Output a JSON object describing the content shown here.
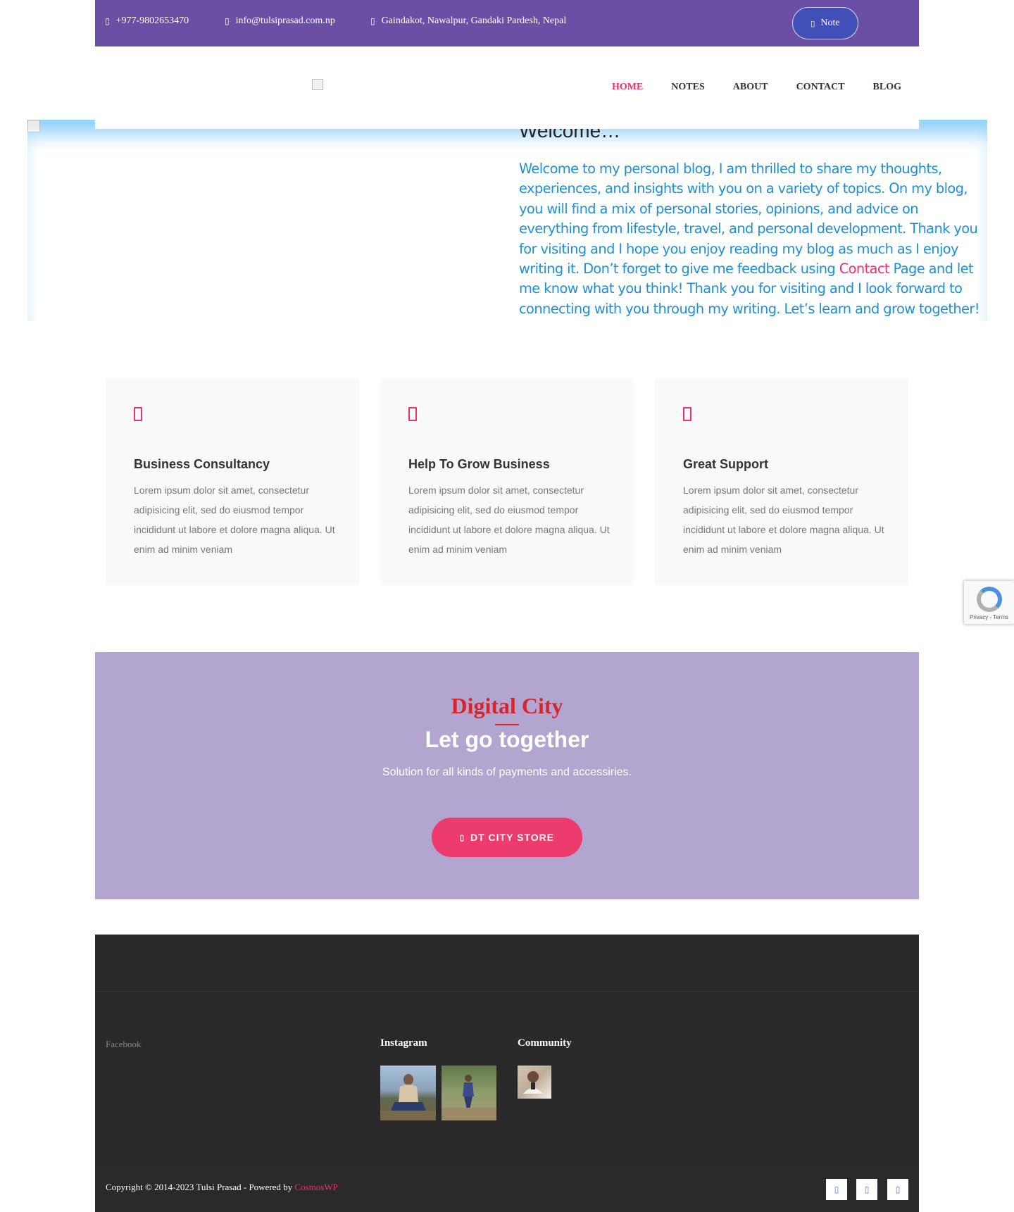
{
  "topbar": {
    "phone": "+977-9802653470",
    "email": "info@tulsiprasad.com.np",
    "address": "Gaindakot, Nawalpur, Gandaki Pardesh, Nepal",
    "note_label": "Note",
    "colors": {
      "bar": "#6a4fa4",
      "note_button": "#4150b8"
    }
  },
  "nav": {
    "items": [
      "HOME",
      "NOTES",
      "ABOUT",
      "CONTACT",
      "BLOG"
    ],
    "active": "HOME",
    "active_color": "#e8336d"
  },
  "hero": {
    "title": "Welcome…",
    "text_before": "Welcome to my personal blog, I am thrilled to share my thoughts, experiences, and insights with you on a variety of topics. On my blog, you will find a mix of personal stories, opinions, and advice on everything from lifestyle, travel, and personal development. Thank you for visiting and I hope you enjoy reading my blog as much as I enjoy writing it. Don’t forget to give me feedback using ",
    "link_text": "Contact",
    "text_after": " Page and let me know what you think! Thank you for visiting and I look forward to connecting with you through my writing. Let’s learn and grow together!"
  },
  "features": [
    {
      "title": "Business Consultancy",
      "text": "Lorem ipsum dolor sit amet, consectetur adipisicing elit, sed do eiusmod tempor incididunt ut labore et dolore magna aliqua. Ut enim ad minim veniam"
    },
    {
      "title": "Help To Grow Business",
      "text": "Lorem ipsum dolor sit amet, consectetur adipisicing elit, sed do eiusmod tempor incididunt ut labore et dolore magna aliqua. Ut enim ad minim veniam"
    },
    {
      "title": "Great Support",
      "text": "Lorem ipsum dolor sit amet, consectetur adipisicing elit, sed do eiusmod tempor incididunt ut labore et dolore magna aliqua. Ut enim ad minim veniam"
    }
  ],
  "recaptcha": {
    "text": "Privacy - Terms"
  },
  "cta": {
    "title": "Digital City",
    "subtitle": "Let go together",
    "description": "Solution for all kinds of payments and accessiries.",
    "button": "DT CITY STORE",
    "colors": {
      "background": "#b2a5cf",
      "title": "#d8252b",
      "button": "#ec3b6c"
    }
  },
  "footer": {
    "facebook": "Facebook",
    "instagram": "Instagram",
    "community": "Community",
    "copyright": "Copyright © 2014-2023 Tulsi Prasad - Powered by ",
    "powered_by": "CosmosWP",
    "social_icons": [
      "facebook-icon",
      "twitter-icon",
      "linkedin-icon"
    ]
  }
}
